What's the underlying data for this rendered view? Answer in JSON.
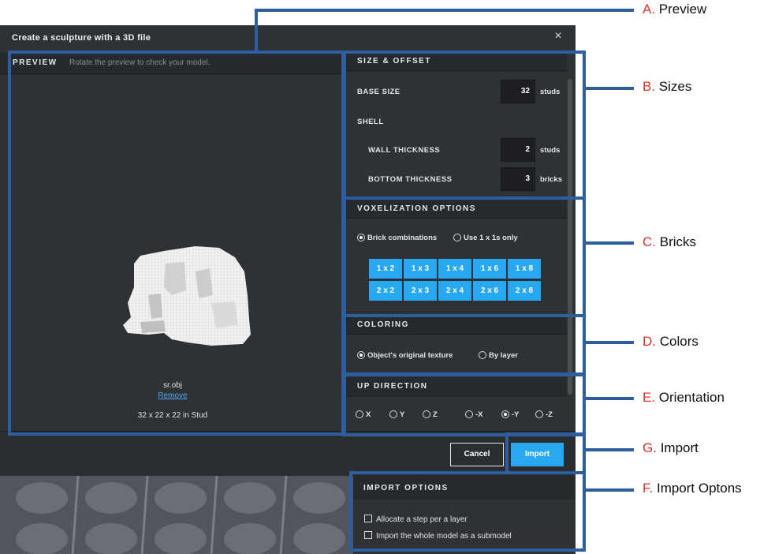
{
  "dialog": {
    "title": "Create a sculpture with a 3D file",
    "close_glyph": "×"
  },
  "preview": {
    "label": "PREVIEW",
    "hint": "Rotate the preview to check your model.",
    "file_name": "sr.obj",
    "remove_label": "Remove",
    "dimensions": "32 x 22 x 22 in Stud"
  },
  "size_offset": {
    "header": "SIZE & OFFSET",
    "base_size_label": "BASE SIZE",
    "base_size_value": "32",
    "base_size_unit": "studs",
    "shell_label": "SHELL",
    "wall_thickness_label": "WALL THICKNESS",
    "wall_thickness_value": "2",
    "wall_thickness_unit": "studs",
    "bottom_thickness_label": "BOTTOM THICKNESS",
    "bottom_thickness_value": "3",
    "bottom_thickness_unit": "bricks"
  },
  "voxelization": {
    "header": "VOXELIZATION OPTIONS",
    "option_combinations": "Brick combinations",
    "option_1x1": "Use 1 x 1s only",
    "selected": "Brick combinations",
    "bricks_row1": [
      "1 x 2",
      "1 x 3",
      "1 x 4",
      "1 x 6",
      "1 x 8"
    ],
    "bricks_row2": [
      "2 x 2",
      "2 x 3",
      "2 x 4",
      "2 x 6",
      "2 x 8"
    ]
  },
  "coloring": {
    "header": "COLORING",
    "option_texture": "Object's original texture",
    "option_layer": "By layer",
    "selected": "Object's original texture"
  },
  "up_direction": {
    "header": "UP DIRECTION",
    "options": [
      "X",
      "Y",
      "Z",
      "-X",
      "-Y",
      "-Z"
    ],
    "selected": "-Y"
  },
  "footer": {
    "cancel_label": "Cancel",
    "import_label": "Import"
  },
  "import_options": {
    "header": "IMPORT OPTIONS",
    "option_step": "Allocate a step per a layer",
    "option_submodel": "Import the whole model as a submodel"
  },
  "callouts": {
    "a_letter": "A.",
    "a_text": "Preview",
    "b_letter": "B.",
    "b_text": "Sizes",
    "c_letter": "C.",
    "c_text": "Bricks",
    "d_letter": "D.",
    "d_text": "Colors",
    "e_letter": "E.",
    "e_text": "Orientation",
    "g_letter": "G.",
    "g_text": "Import",
    "f_letter": "F.",
    "f_text": "Import Optons"
  },
  "colors": {
    "annotation": "#2d5e9e",
    "callout_letter": "#e03030",
    "accent": "#29a8f2",
    "dialog_bg": "#2e3136"
  }
}
